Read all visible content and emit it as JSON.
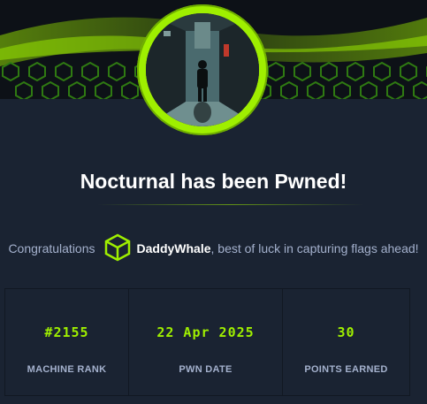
{
  "header": {
    "title": "Nocturnal has been Pwned!"
  },
  "congrats": {
    "prefix": "Congratulations",
    "username": "DaddyWhale",
    "suffix": ", best of luck in capturing flags ahead!"
  },
  "stats": [
    {
      "value": "#2155",
      "label": "MACHINE RANK"
    },
    {
      "value": "22 Apr 2025",
      "label": "PWN DATE"
    },
    {
      "value": "30",
      "label": "POINTS EARNED"
    }
  ],
  "colors": {
    "accent": "#9fef00",
    "background": "#1a2332",
    "muted_text": "#a4b1cd",
    "border": "#111822"
  },
  "icons": {
    "user_avatar": "hexagon-cube-icon",
    "machine_avatar": "machine-avatar-icon"
  }
}
